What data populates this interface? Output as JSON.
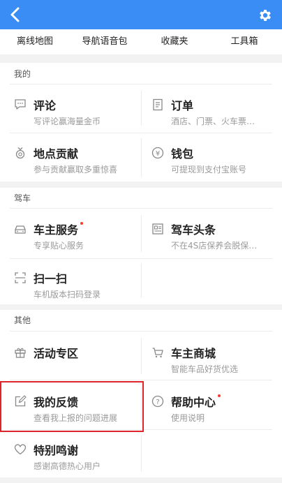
{
  "header": {
    "back_icon": "chevron-left-icon",
    "settings_icon": "gear-icon",
    "bar_color": "#3b8df6"
  },
  "tools": [
    "离线地图",
    "导航语音包",
    "收藏夹",
    "工具箱"
  ],
  "sections": {
    "mine": {
      "title": "我的",
      "items": [
        {
          "title": "评论",
          "sub": "写评论赢海量金币",
          "icon": "comment-icon"
        },
        {
          "title": "订单",
          "sub": "酒店、门票、火车票…",
          "icon": "order-icon"
        },
        {
          "title": "地点贡献",
          "sub": "参与贡献赢取多重惊喜",
          "icon": "medal-icon"
        },
        {
          "title": "钱包",
          "sub": "可提现到支付宝账号",
          "icon": "wallet-icon"
        }
      ]
    },
    "drive": {
      "title": "驾车",
      "items": [
        {
          "title": "车主服务",
          "sub": "专享贴心服务",
          "icon": "car-icon",
          "dot": true
        },
        {
          "title": "驾车头条",
          "sub": "不在4S店保养会脱保…",
          "icon": "news-icon"
        },
        {
          "title": "扫一扫",
          "sub": "车机版本扫码登录",
          "icon": "scan-icon"
        }
      ]
    },
    "other": {
      "title": "其他",
      "items": [
        {
          "title": "活动专区",
          "sub": "",
          "icon": "gift-icon"
        },
        {
          "title": "车主商城",
          "sub": "智能车品好货优选",
          "icon": "cart-icon"
        },
        {
          "title": "我的反馈",
          "sub": "查看我上报的问题进展",
          "icon": "edit-icon"
        },
        {
          "title": "帮助中心",
          "sub": "使用说明",
          "icon": "help-icon",
          "dot": true
        },
        {
          "title": "特别鸣谢",
          "sub": "感谢高德热心用户",
          "icon": "heart-icon"
        }
      ]
    }
  },
  "colors": {
    "accent": "#3b8df6",
    "badge": "#ff3b30",
    "highlight": "#e0242b"
  }
}
